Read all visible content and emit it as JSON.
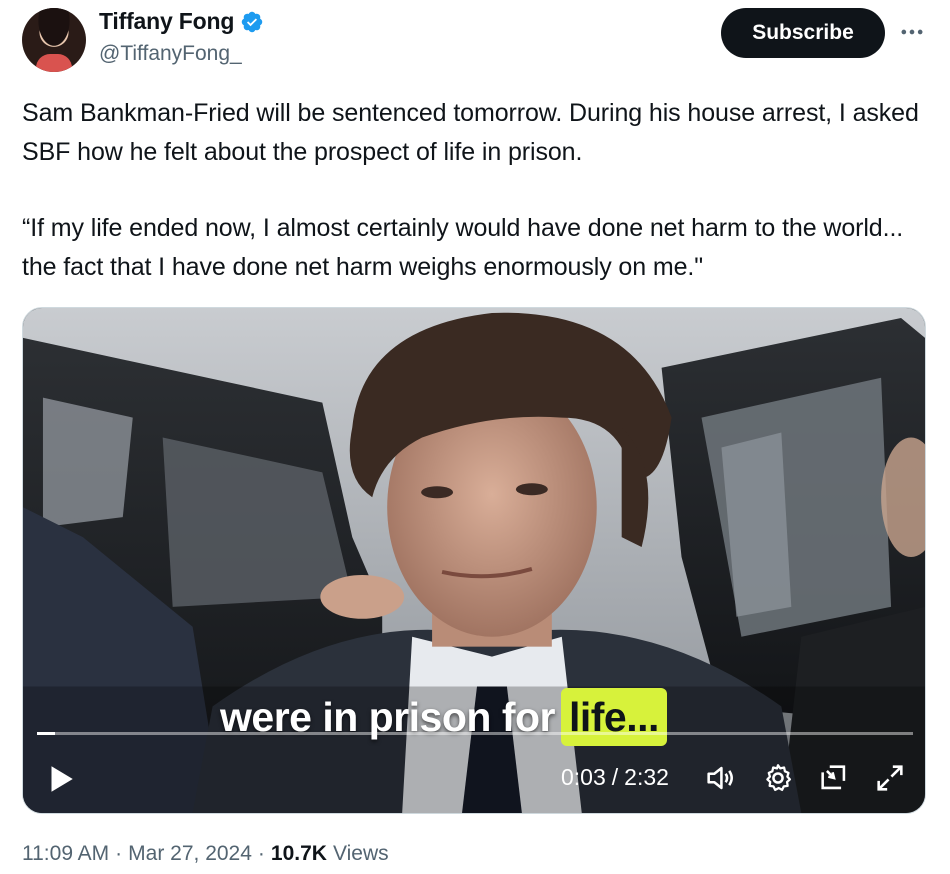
{
  "author": {
    "name": "Tiffany Fong",
    "handle": "@TiffanyFong_",
    "verified": true,
    "verified_color": "#1d9bf0"
  },
  "header": {
    "subscribe_label": "Subscribe",
    "more_icon": "more-horizontal-icon"
  },
  "tweet": {
    "paragraph_1": "Sam Bankman-Fried will be sentenced tomorrow. During his house arrest, I asked SBF how he felt about the prospect of life in prison.",
    "paragraph_2": "“If my life ended now, I almost certainly would have done net harm to the world... the fact that I have done net harm weighs enormously on me.\""
  },
  "video": {
    "caption_prefix": "were in prison for",
    "caption_highlight": "life...",
    "caption_highlight_color": "#d7f23b",
    "current_time": "0:03",
    "separator": "/",
    "duration": "2:32",
    "progress_fraction": 0.02,
    "icons": [
      "play-icon",
      "volume-icon",
      "settings-gear-icon",
      "share-out-icon",
      "fullscreen-icon"
    ]
  },
  "footer": {
    "time": "11:09 AM",
    "dot": "·",
    "date": "Mar 27, 2024",
    "views_count": "10.7K",
    "views_label": "Views"
  }
}
